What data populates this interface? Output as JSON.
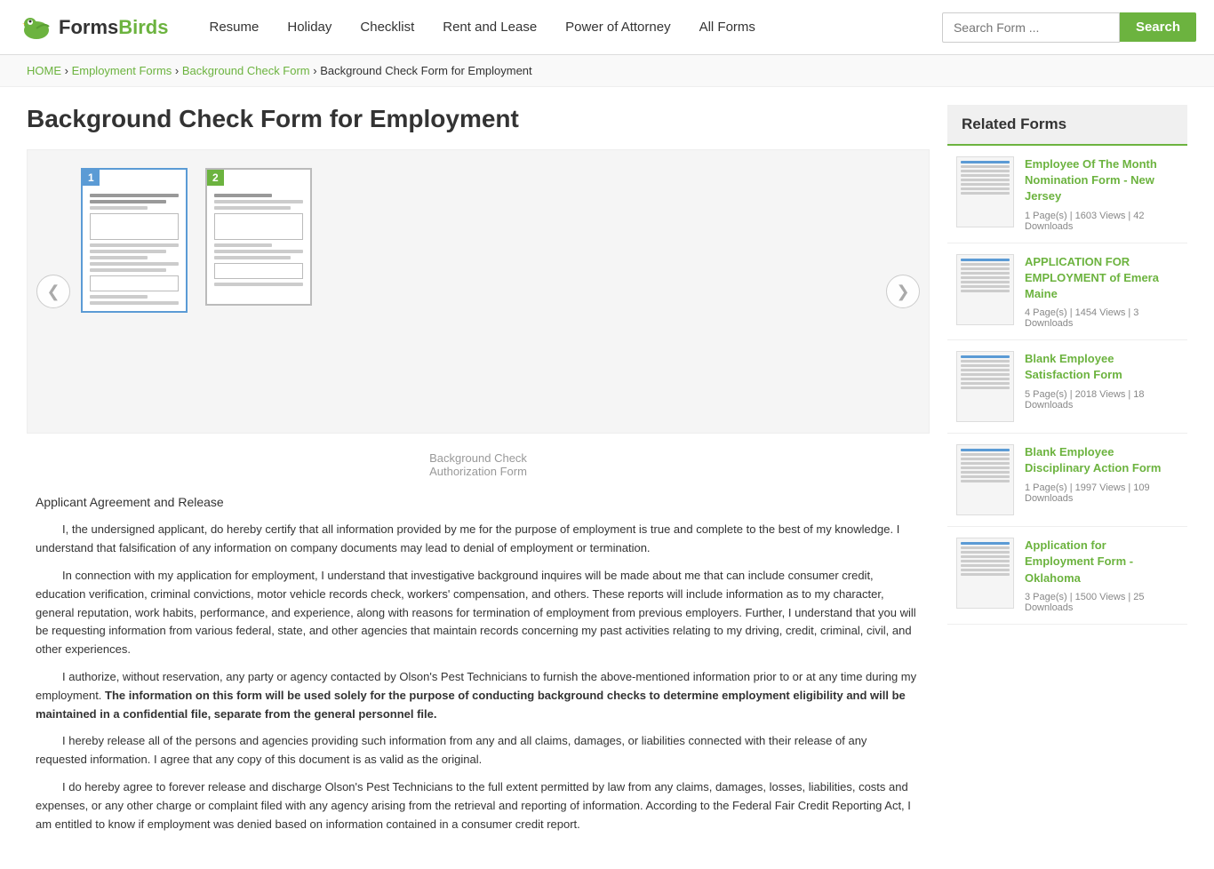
{
  "header": {
    "logo_forms": "Forms",
    "logo_birds": "Birds",
    "nav": [
      {
        "label": "Resume",
        "href": "#"
      },
      {
        "label": "Holiday",
        "href": "#"
      },
      {
        "label": "Checklist",
        "href": "#"
      },
      {
        "label": "Rent and Lease",
        "href": "#"
      },
      {
        "label": "Power of Attorney",
        "href": "#"
      },
      {
        "label": "All Forms",
        "href": "#"
      }
    ],
    "search_placeholder": "Search Form ...",
    "search_button": "Search"
  },
  "breadcrumb": {
    "home": "HOME",
    "employment_forms": "Employment Forms",
    "background_check_form": "Background Check Form",
    "current": "Background Check Form for Employment"
  },
  "page_title": "Background Check Form for Employment",
  "form_viewer": {
    "prev_arrow": "❮",
    "next_arrow": "❯",
    "page1_num": "1",
    "page2_num": "2",
    "subtitle_line1": "Background Check",
    "subtitle_line2": "Authorization Form"
  },
  "form_text": {
    "section_title": "Applicant Agreement and Release",
    "paragraph1": "I, the undersigned applicant, do hereby certify that all information provided by me for the purpose of employment is true and complete to the best of my knowledge. I understand that falsification of any information on company documents may lead to denial of employment or termination.",
    "paragraph2": "In connection with my application for employment, I understand that investigative background inquires will be made about me that can include consumer credit, education verification, criminal convictions, motor vehicle records check, workers' compensation, and others. These reports will include information as to my character, general reputation, work habits, performance, and experience, along with reasons for termination of employment from previous employers. Further, I understand that you will be requesting information from various federal, state, and other agencies that maintain records concerning my past activities relating to my driving, credit, criminal, civil, and other experiences.",
    "paragraph3_start": "I authorize, without reservation, any party or agency contacted by Olson's Pest Technicians to furnish the above-mentioned information prior to or at any time during my employment. ",
    "paragraph3_bold": "The information on this form will be used solely for the purpose of conducting background checks to determine employment eligibility and will be maintained in a confidential file, separate from the general personnel file.",
    "paragraph4": "I hereby release all of the persons and agencies providing such information from any and all claims, damages, or liabilities connected with their release of any requested information. I agree that any copy of this document is as valid as the original.",
    "paragraph5": "I do hereby agree to forever release and discharge Olson's Pest Technicians to the full extent permitted by law from any claims, damages, losses, liabilities, costs and expenses, or any other charge or complaint filed with any agency arising from the retrieval and reporting of information. According to the Federal Fair Credit Reporting Act, I am entitled to know if employment was denied based on information contained in a consumer credit report."
  },
  "related_forms": {
    "title": "Related Forms",
    "items": [
      {
        "name": "Employee Of The Month Nomination Form - New Jersey",
        "pages": "1 Page(s)",
        "views": "1603 Views",
        "downloads": "42 Downloads"
      },
      {
        "name": "APPLICATION FOR EMPLOYMENT of Emera Maine",
        "pages": "4 Page(s)",
        "views": "1454 Views",
        "downloads": "3 Downloads"
      },
      {
        "name": "Blank Employee Satisfaction Form",
        "pages": "5 Page(s)",
        "views": "2018 Views",
        "downloads": "18 Downloads"
      },
      {
        "name": "Blank Employee Disciplinary Action Form",
        "pages": "1 Page(s)",
        "views": "1997 Views",
        "downloads": "109 Downloads"
      },
      {
        "name": "Application for Employment Form - Oklahoma",
        "pages": "3 Page(s)",
        "views": "1500 Views",
        "downloads": "25 Downloads"
      }
    ]
  },
  "next_page_chevron": "›"
}
